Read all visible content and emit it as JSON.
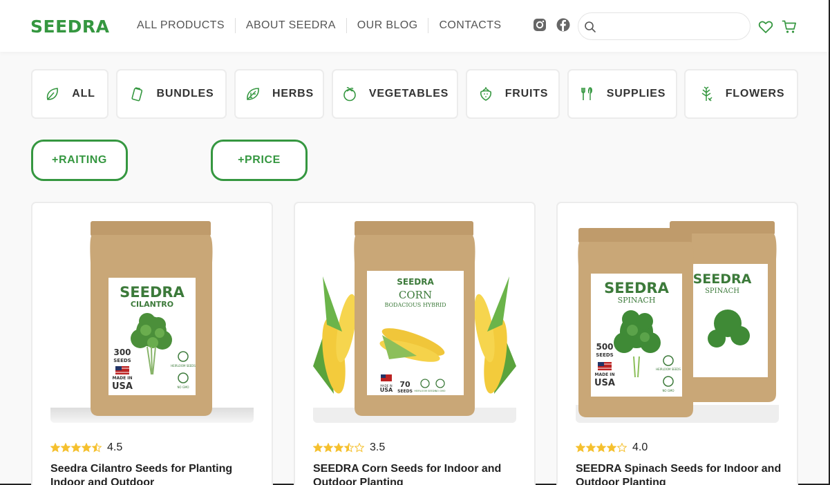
{
  "brand": {
    "logo": "SEEDRA",
    "accent": "#359740"
  },
  "nav": [
    "ALL PRODUCTS",
    "ABOUT SEEDRA",
    "OUR BLOG",
    "CONTACTS"
  ],
  "social_icons": [
    "instagram-icon",
    "facebook-icon"
  ],
  "search": {
    "placeholder": "",
    "value": ""
  },
  "header_icons": [
    "heart-icon",
    "cart-icon"
  ],
  "categories": [
    {
      "label": "ALL",
      "icon": "leaf-icon"
    },
    {
      "label": "BUNDLES",
      "icon": "bundle-pack-icon"
    },
    {
      "label": "HERBS",
      "icon": "herb-leaf-icon"
    },
    {
      "label": "VEGETABLES",
      "icon": "vegetable-icon"
    },
    {
      "label": "FRUITS",
      "icon": "strawberry-icon"
    },
    {
      "label": "SUPPLIES",
      "icon": "garden-tools-icon"
    },
    {
      "label": "FLOWERS",
      "icon": "flower-icon"
    }
  ],
  "filters": [
    "+RAITING",
    "+PRICE"
  ],
  "products": [
    {
      "rating": "4.5",
      "rating_value": 4.5,
      "title": "Seedra Cilantro Seeds for Planting Indoor and Outdoor",
      "pack": {
        "brand": "SEEDRA",
        "name": "CILANTRO",
        "subtitle": "",
        "count": "300",
        "unit": "SEEDS",
        "made_in": "MADE IN",
        "country": "USA",
        "badge1": "HEIRLOOM SEEDS",
        "badge2": "NO GMO"
      }
    },
    {
      "rating": "3.5",
      "rating_value": 3.5,
      "title": "SEEDRA Corn Seeds for Indoor and Outdoor Planting",
      "pack": {
        "brand": "SEEDRA",
        "name": "CORN",
        "subtitle": "BODACIOUS HYBRID",
        "count": "70",
        "unit": "SEEDS",
        "made_in": "MADE IN",
        "country": "USA",
        "badge1": "HEIRLOOM SEEDS",
        "badge2": "NO GMO"
      }
    },
    {
      "rating": "4.0",
      "rating_value": 4.0,
      "title": "SEEDRA Spinach Seeds for Indoor and Outdoor Planting",
      "pack": {
        "brand": "SEEDRA",
        "name": "SPINACH",
        "subtitle": "",
        "count": "500",
        "unit": "SEEDS",
        "made_in": "MADE IN",
        "country": "USA",
        "badge1": "HEIRLOOM SEEDS",
        "badge2": "NO GMO"
      }
    }
  ],
  "colors": {
    "star": "#f5c02e",
    "kraft": "#c9a777",
    "label_green": "#3c7a3a"
  }
}
